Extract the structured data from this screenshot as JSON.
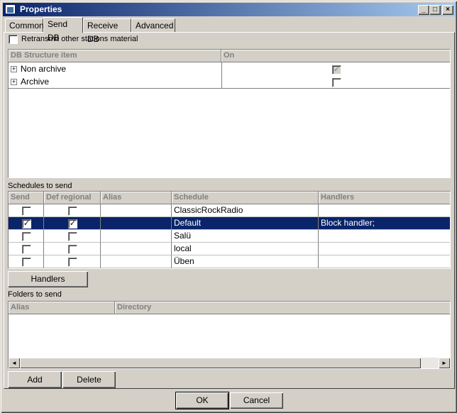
{
  "window": {
    "title": "Properties",
    "minimize": "_",
    "maximize": "□",
    "close": "×"
  },
  "tabs": [
    {
      "label": "Common"
    },
    {
      "label": "Send DB"
    },
    {
      "label": "Receive DB"
    },
    {
      "label": "Advanced"
    }
  ],
  "retransmit": {
    "label": "Retransmit other stations material",
    "checked": false
  },
  "db_structure": {
    "columns": [
      "DB Structure item",
      "On"
    ],
    "rows": [
      {
        "expand": "+",
        "item": "Non archive",
        "on": "✓"
      },
      {
        "expand": "+",
        "item": "Archive",
        "on": ""
      }
    ]
  },
  "schedules": {
    "section_label": "Schedules to send",
    "columns": [
      "Send",
      "Def regional",
      "Alias",
      "Schedule",
      "Handlers"
    ],
    "rows": [
      {
        "send": "",
        "def_regional": "",
        "alias": "",
        "schedule": "ClassicRockRadio",
        "handlers": ""
      },
      {
        "send": "✓",
        "def_regional": "✓",
        "alias": "",
        "schedule": "Default",
        "handlers": "Block handler;"
      },
      {
        "send": "",
        "def_regional": "",
        "alias": "",
        "schedule": "Salü",
        "handlers": ""
      },
      {
        "send": "",
        "def_regional": "",
        "alias": "",
        "schedule": "local",
        "handlers": ""
      },
      {
        "send": "",
        "def_regional": "",
        "alias": "",
        "schedule": "Üben",
        "handlers": ""
      }
    ],
    "selected_row": 1,
    "handlers_button": "Handlers"
  },
  "folders": {
    "section_label": "Folders to send",
    "columns": [
      "Alias",
      "Directory"
    ],
    "scroll_left": "◄",
    "scroll_right": "►",
    "add_button": "Add",
    "delete_button": "Delete"
  },
  "footer": {
    "ok": "OK",
    "cancel": "Cancel"
  },
  "colors": {
    "selection": "#0a246a",
    "face": "#d4d0c8"
  }
}
